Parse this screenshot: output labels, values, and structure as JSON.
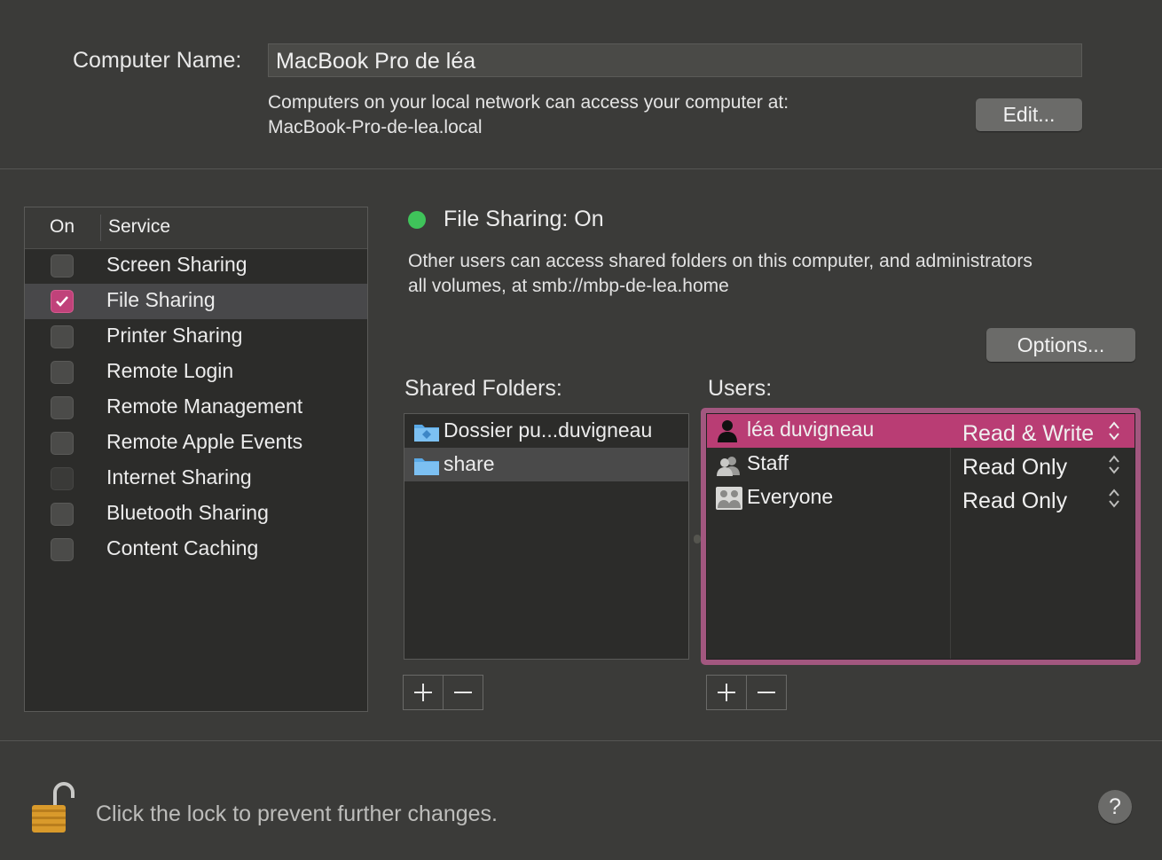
{
  "computer_name": {
    "label": "Computer Name:",
    "value": "MacBook Pro de léa",
    "network_line1": "Computers on your local network can access your computer at:",
    "network_line2": "MacBook-Pro-de-lea.local",
    "edit_button": "Edit..."
  },
  "services": {
    "header_on": "On",
    "header_service": "Service",
    "items": [
      {
        "name": "Screen Sharing",
        "checked": false
      },
      {
        "name": "File Sharing",
        "checked": true,
        "selected": true
      },
      {
        "name": "Printer Sharing",
        "checked": false
      },
      {
        "name": "Remote Login",
        "checked": false
      },
      {
        "name": "Remote Management",
        "checked": false
      },
      {
        "name": "Remote Apple Events",
        "checked": false
      },
      {
        "name": "Internet Sharing",
        "checked": false,
        "disabled": true
      },
      {
        "name": "Bluetooth Sharing",
        "checked": false
      },
      {
        "name": "Content Caching",
        "checked": false
      }
    ]
  },
  "status": {
    "title": "File Sharing: On",
    "color": "#3fc35a",
    "desc_line1": "Other users can access shared folders on this computer, and administrators",
    "desc_line2": "all volumes, at smb://mbp-de-lea.home",
    "options_button": "Options..."
  },
  "shared_folders": {
    "label": "Shared Folders:",
    "items": [
      {
        "name": "Dossier pu...duvigneau",
        "icon": "public-folder-icon"
      },
      {
        "name": "share",
        "icon": "folder-icon",
        "selected": true
      }
    ]
  },
  "users": {
    "label": "Users:",
    "items": [
      {
        "name": "léa duvigneau",
        "permission": "Read & Write",
        "icon": "user-icon",
        "selected": true
      },
      {
        "name": "Staff",
        "permission": "Read Only",
        "icon": "group-icon"
      },
      {
        "name": "Everyone",
        "permission": "Read Only",
        "icon": "everyone-icon"
      }
    ]
  },
  "footer": {
    "lock_text": "Click the lock to prevent further changes.",
    "help_button": "?"
  },
  "colors": {
    "accent": "#c0427a",
    "focus_ring": "#a2577f",
    "background": "#3b3b39"
  }
}
